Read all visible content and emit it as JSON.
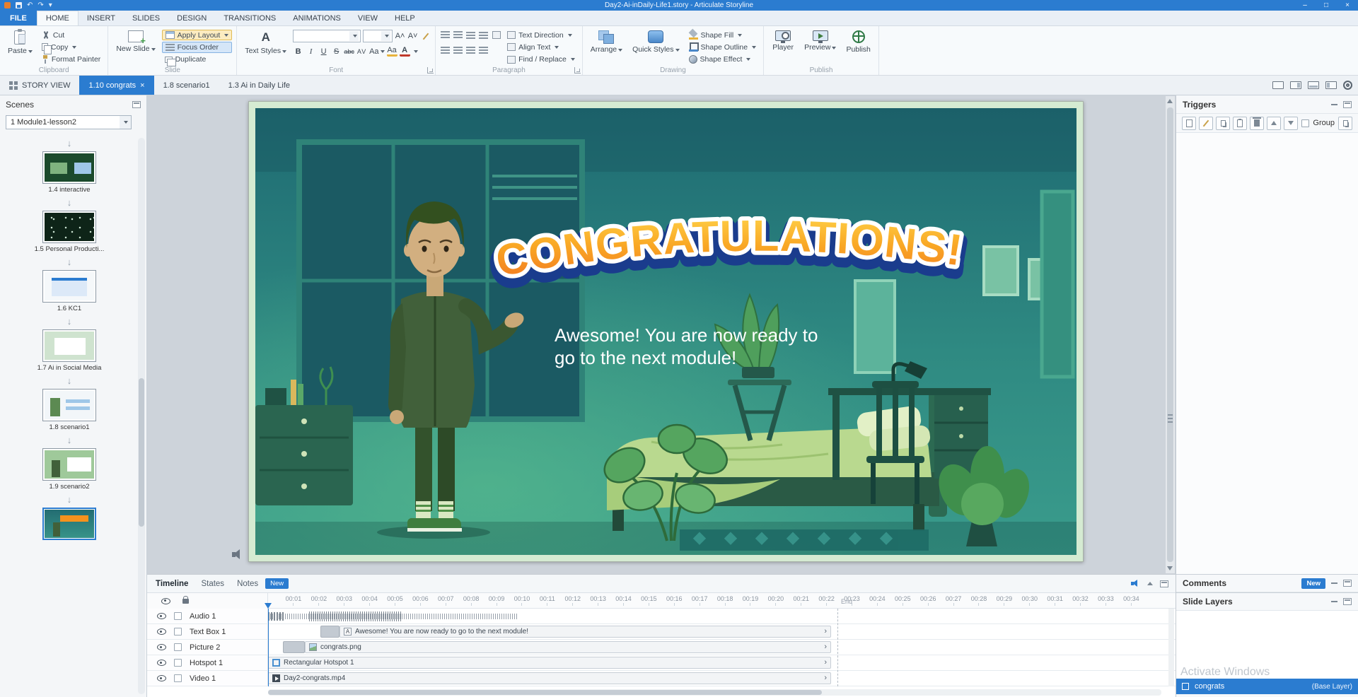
{
  "glyphs": {
    "close": "×",
    "min": "–",
    "max": "□",
    "undo": "↶",
    "redo": "↷",
    "caret_small": "▾",
    "chevron": "›",
    "scene_arrow": "↓"
  },
  "window": {
    "title": "Day2-Ai-inDaily-Life1.story - Articulate Storyline"
  },
  "menu": {
    "file": "FILE",
    "items": [
      "HOME",
      "INSERT",
      "SLIDES",
      "DESIGN",
      "TRANSITIONS",
      "ANIMATIONS",
      "VIEW",
      "HELP"
    ],
    "active": "HOME"
  },
  "ribbon": {
    "clipboard": {
      "group": "Clipboard",
      "paste": "Paste",
      "cut": "Cut",
      "copy": "Copy",
      "format_painter": "Format Painter"
    },
    "slide": {
      "group": "Slide",
      "new_slide": "New Slide",
      "apply_layout": "Apply Layout",
      "focus_order": "Focus Order",
      "duplicate": "Duplicate"
    },
    "font": {
      "group": "Font",
      "text_styles": "Text Styles",
      "font_name": "",
      "font_size": "",
      "bold": "B",
      "italic": "I",
      "underline": "U",
      "strike": "S",
      "abc": "abc",
      "grow": "A",
      "shrink": "A",
      "spacing": "AV",
      "case": "Aa",
      "color": "A"
    },
    "paragraph": {
      "group": "Paragraph",
      "text_direction": "Text Direction",
      "align_text": "Align Text",
      "find_replace": "Find / Replace"
    },
    "drawing": {
      "group": "Drawing",
      "arrange": "Arrange",
      "quick_styles": "Quick Styles",
      "shape_fill": "Shape Fill",
      "shape_outline": "Shape Outline",
      "shape_effect": "Shape Effect"
    },
    "publish": {
      "group": "Publish",
      "player": "Player",
      "preview": "Preview",
      "publish": "Publish"
    }
  },
  "tabbar": {
    "story_view": "STORY VIEW",
    "active_tab": "1.10 congrats",
    "tabs": [
      "1.8 scenario1",
      "1.3 Ai in Daily Life"
    ]
  },
  "scenes": {
    "title": "Scenes",
    "dropdown_value": "1 Module1-lesson2",
    "thumbnails": [
      {
        "label": "1.4 interactive"
      },
      {
        "label": "1.5 Personal Producti..."
      },
      {
        "label": "1.6 KC1"
      },
      {
        "label": "1.7 Ai in Social Media"
      },
      {
        "label": "1.8 scenario1"
      },
      {
        "label": "1.9 scenario2"
      },
      {
        "label": ""
      }
    ]
  },
  "slide": {
    "banner": "CONGRATULATIONS!",
    "message_line1": "Awesome! You are now ready to",
    "message_line2": "go to the next module!"
  },
  "timeline": {
    "tabs": {
      "timeline": "Timeline",
      "states": "States",
      "notes": "Notes",
      "badge": "New"
    },
    "ruler": [
      "00:01",
      "00:02",
      "00:03",
      "00:04",
      "00:05",
      "00:06",
      "00:07",
      "00:08",
      "00:09",
      "00:10",
      "00:11",
      "00:12",
      "00:13",
      "00:14",
      "00:15",
      "00:16",
      "00:17",
      "00:18",
      "00:19",
      "00:20",
      "00:21",
      "00:22",
      "00:23",
      "00:24",
      "00:25",
      "00:26",
      "00:27",
      "00:28",
      "00:29",
      "00:30",
      "00:31",
      "00:32",
      "00:33",
      "00:34"
    ],
    "end_label": "End",
    "rows": [
      {
        "name": "Audio 1",
        "label": ""
      },
      {
        "name": "Text Box 1",
        "label": "Awesome! You are now ready to go to the next module!"
      },
      {
        "name": "Picture 2",
        "label": "congrats.png"
      },
      {
        "name": "Hotspot 1",
        "label": "Rectangular Hotspot 1"
      },
      {
        "name": "Video 1",
        "label": "Day2-congrats.mp4"
      }
    ]
  },
  "panels": {
    "triggers": {
      "title": "Triggers",
      "group_label": "Group"
    },
    "comments": {
      "title": "Comments",
      "badge": "New"
    },
    "slide_layers": {
      "title": "Slide Layers",
      "base_layer_name": "congrats",
      "base_layer_tag": "(Base Layer)"
    }
  },
  "watermark": "Activate Windows",
  "colors": {
    "accent": "#2b7cd0",
    "banner_orange": "#f6921e",
    "banner_navy": "#1a3c8d",
    "scene_teal": "#2e8a82",
    "slide_frame": "#d5ebd2"
  }
}
